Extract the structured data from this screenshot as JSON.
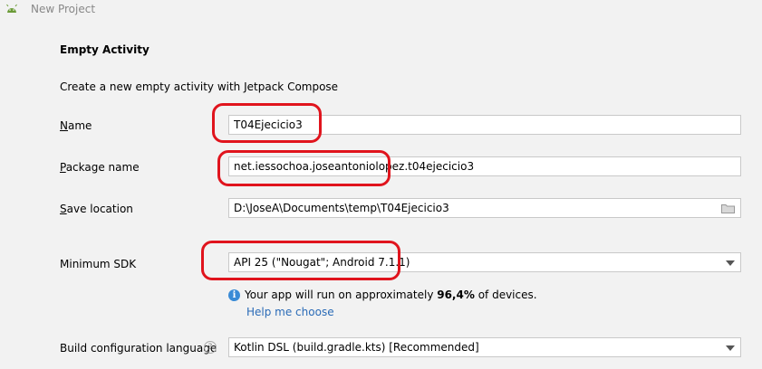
{
  "window": {
    "title": "New Project"
  },
  "page": {
    "heading": "Empty Activity",
    "description": "Create a new empty activity with Jetpack Compose"
  },
  "form": {
    "name": {
      "label_u": "N",
      "label_rest": "ame",
      "value": "T04Ejecicio3"
    },
    "package": {
      "label_u": "P",
      "label_rest": "ackage name",
      "value": "net.iessochoa.joseantoniolopez.t04ejecicio3"
    },
    "save_location": {
      "label_u": "S",
      "label_rest": "ave location",
      "value": "D:\\JoseA\\Documents\\temp\\T04Ejecicio3"
    },
    "min_sdk": {
      "label": "Minimum SDK",
      "value": "API 25 (\"Nougat\"; Android 7.1.1)"
    },
    "sdk_info": {
      "prefix": "Your app will run on approximately ",
      "percent": "96,4%",
      "suffix": " of devices.",
      "help_link": "Help me choose"
    },
    "build_lang": {
      "label": "Build configuration language",
      "help_glyph": "?",
      "value": "Kotlin DSL (build.gradle.kts) [Recommended]"
    }
  },
  "icons": {
    "window": "android-icon",
    "folder": "folder-icon",
    "info": "info-icon",
    "dropdown": "chevron-down-icon"
  },
  "colors": {
    "highlight": "#e0141d",
    "link": "#2a6bb7",
    "info": "#3a8bd6"
  }
}
